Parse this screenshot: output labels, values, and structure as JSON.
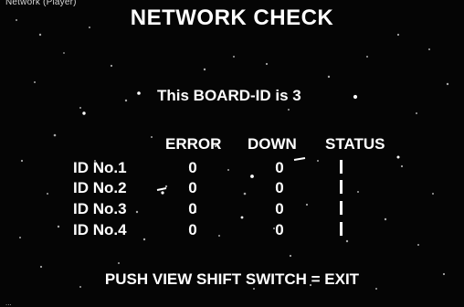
{
  "caption": {
    "top_text": "Network (Player)",
    "bottom_text": "..."
  },
  "screen": {
    "title": "NETWORK CHECK",
    "board_id_text": "This BOARD-ID is 3",
    "columns": {
      "error": "ERROR",
      "down": "DOWN",
      "status": "STATUS"
    },
    "rows": [
      {
        "label": "ID No.1",
        "error": "0",
        "down": "0",
        "status": "|"
      },
      {
        "label": "ID No.2",
        "error": "0",
        "down": "0",
        "status": "|"
      },
      {
        "label": "ID No.3",
        "error": "0",
        "down": "0",
        "status": "|"
      },
      {
        "label": "ID No.4",
        "error": "0",
        "down": "0",
        "status": "|"
      }
    ],
    "footer": "PUSH VIEW SHIFT SWITCH = EXIT"
  },
  "colors": {
    "background": "#050505",
    "text": "#ffffff"
  }
}
